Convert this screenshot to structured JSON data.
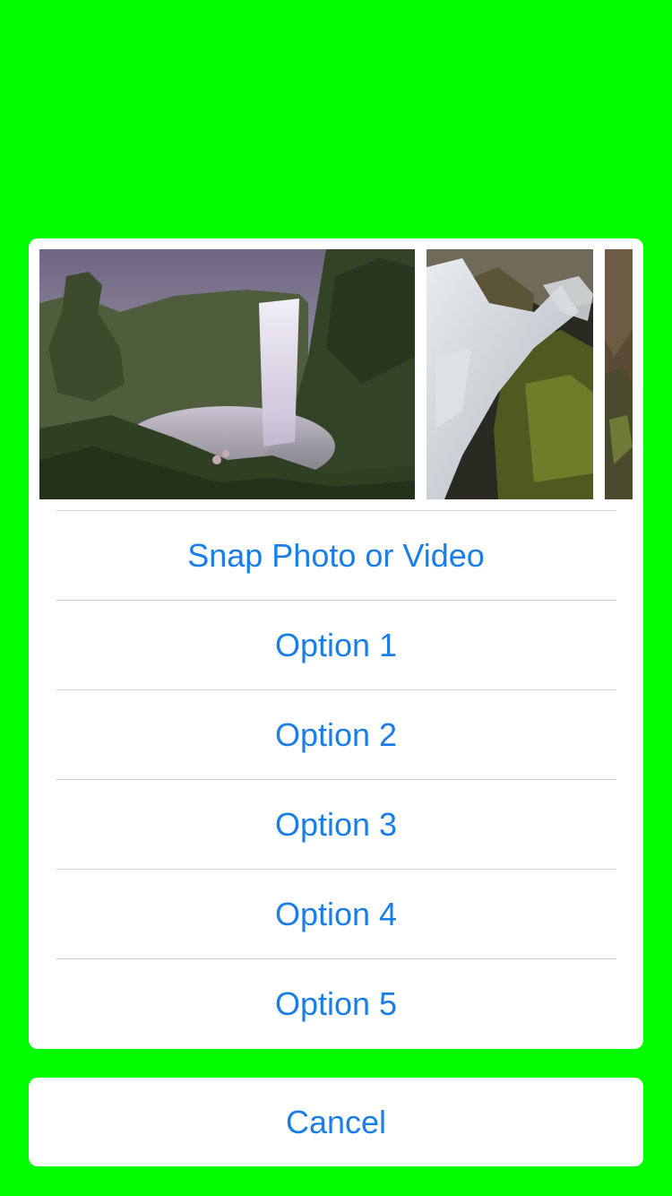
{
  "colors": {
    "background": "#00ff00",
    "sheet": "#ffffff",
    "action_text": "#1a7ee8",
    "separator": "#cfcfcf"
  },
  "photos": [
    {
      "name": "waterfall-canyon-photo"
    },
    {
      "name": "rapids-rocks-photo"
    },
    {
      "name": "partial-rock-photo"
    }
  ],
  "actions": {
    "snap": "Snap Photo or Video",
    "options": [
      "Option 1",
      "Option 2",
      "Option 3",
      "Option 4",
      "Option 5"
    ]
  },
  "cancel": "Cancel"
}
